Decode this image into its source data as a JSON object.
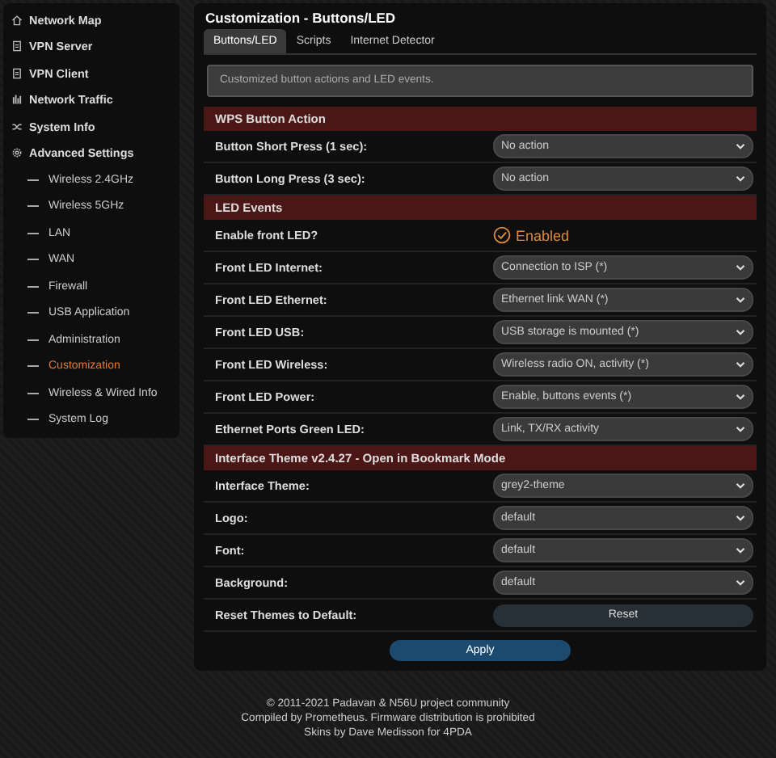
{
  "sidebar": {
    "items": [
      {
        "label": "Network Map",
        "selected": false
      },
      {
        "label": "VPN Server",
        "selected": false
      },
      {
        "label": "VPN Client",
        "selected": false
      },
      {
        "label": "Network Traffic",
        "selected": false
      },
      {
        "label": "System Info",
        "selected": false
      },
      {
        "label": "Advanced Settings",
        "selected": false,
        "children": [
          {
            "label": "Wireless 2.4GHz",
            "selected": false
          },
          {
            "label": "Wireless 5GHz",
            "selected": false
          },
          {
            "label": "LAN",
            "selected": false
          },
          {
            "label": "WAN",
            "selected": false
          },
          {
            "label": "Firewall",
            "selected": false
          },
          {
            "label": "USB Application",
            "selected": false
          },
          {
            "label": "Administration",
            "selected": false
          },
          {
            "label": "Customization",
            "selected": true
          },
          {
            "label": "Wireless & Wired Info",
            "selected": false
          },
          {
            "label": "System Log",
            "selected": false
          }
        ]
      }
    ]
  },
  "page": {
    "title": "Customization - Buttons/LED",
    "tabs": [
      {
        "label": "Buttons/LED",
        "selected": true
      },
      {
        "label": "Scripts",
        "selected": false
      },
      {
        "label": "Internet Detector",
        "selected": false
      }
    ],
    "info": "Customized button actions and LED events.",
    "sections": [
      {
        "title": "WPS Button Action",
        "rows": [
          {
            "kind": "select",
            "label": "Button Short Press (1 sec):",
            "value": "No action"
          },
          {
            "kind": "select",
            "label": "Button Long Press (3 sec):",
            "value": "No action"
          }
        ]
      },
      {
        "title": "LED Events",
        "rows": [
          {
            "kind": "toggle",
            "label": "Enable front LED?",
            "value": "Enabled",
            "on": true
          },
          {
            "kind": "select",
            "label": "Front LED Internet:",
            "value": "Connection to ISP (*)"
          },
          {
            "kind": "select",
            "label": "Front LED Ethernet:",
            "value": "Ethernet link WAN (*)"
          },
          {
            "kind": "select",
            "label": "Front LED USB:",
            "value": "USB storage is mounted (*)"
          },
          {
            "kind": "select",
            "label": "Front LED Wireless:",
            "value": "Wireless radio ON, activity (*)"
          },
          {
            "kind": "select",
            "label": "Front LED Power:",
            "value": "Enable, buttons events (*)"
          },
          {
            "kind": "select",
            "label": "Ethernet Ports Green LED:",
            "value": "Link, TX/RX activity"
          }
        ]
      },
      {
        "title": "Interface Theme v2.4.27 - Open in Bookmark Mode",
        "rows": [
          {
            "kind": "select",
            "label": "Interface Theme:",
            "value": "grey2-theme"
          },
          {
            "kind": "select",
            "label": "Logo:",
            "value": "default"
          },
          {
            "kind": "select",
            "label": "Font:",
            "value": "default"
          },
          {
            "kind": "select",
            "label": "Background:",
            "value": "default"
          },
          {
            "kind": "button",
            "label": "Reset Themes to Default:",
            "value": "Reset"
          }
        ]
      }
    ],
    "apply": "Apply"
  },
  "footer": [
    "© 2011-2021 Padavan & N56U project community",
    "Compiled by Prometheus. Firmware distribution is prohibited",
    "Skins by Dave Medisson for 4PDA"
  ]
}
